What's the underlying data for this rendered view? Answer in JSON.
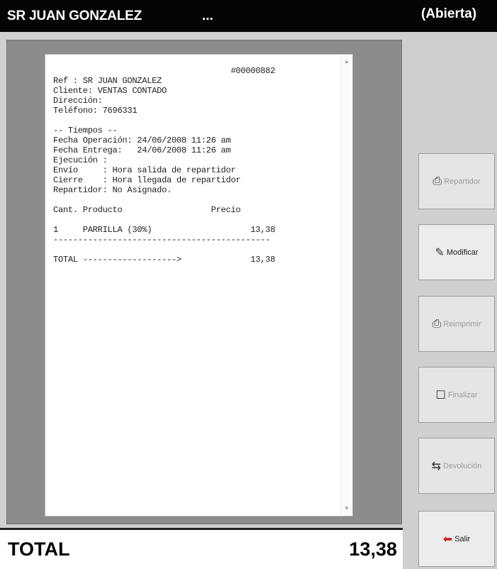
{
  "window": {
    "title": "SR JUAN GONZALEZ",
    "ellipsis": "...",
    "status": "(Abierta)"
  },
  "receipt": {
    "lines": [
      "                                    #00000882",
      "Ref : SR JUAN GONZALEZ",
      "Cliente: VENTAS CONTADO",
      "Dirección:",
      "Teléfono: 7696331",
      "",
      "-- Tiempos --",
      "Fecha Operación: 24/06/2008 11:26 am",
      "Fecha Entrega:   24/06/2008 11:26 am",
      "Ejecución :",
      "Envío     : Hora salida de repartidor",
      "Cierre    : Hora llegada de repartidor",
      "Repartidor: No Asignado.",
      "",
      "Cant. Producto                  Precio",
      "",
      "1     PARRILLA (30%)                    13,38",
      "--------------------------------------------",
      "",
      "TOTAL ------------------->              13,38"
    ]
  },
  "total": {
    "label": "TOTAL",
    "value": "13,38"
  },
  "buttons": {
    "repartidor": {
      "label": "Repartidor",
      "icon": "delivery-icon"
    },
    "modificar": {
      "label": "Modificar",
      "icon": "edit-icon"
    },
    "reimprimir": {
      "label": "Reimprimir",
      "icon": "printer-icon"
    },
    "finalizar": {
      "label": "Finalizar",
      "icon": "finish-icon"
    },
    "devolucion": {
      "label": "Devolución",
      "icon": "return-icon"
    },
    "salir": {
      "label": "Salir",
      "icon": "exit-door-icon"
    }
  }
}
